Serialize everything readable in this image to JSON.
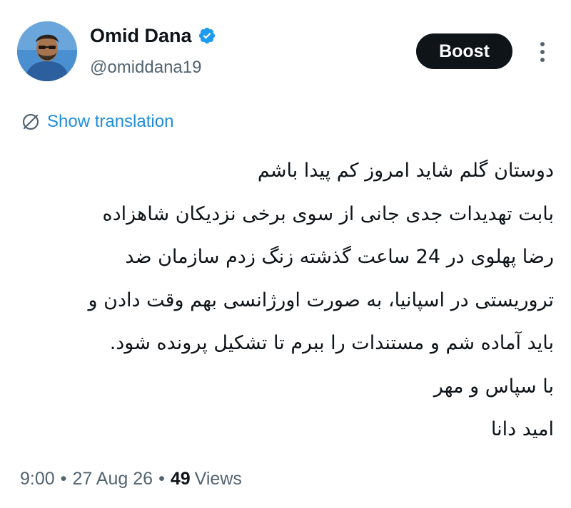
{
  "author": {
    "display_name": "Omid Dana",
    "handle": "@omiddana19",
    "verified_icon": "verified-badge-icon",
    "verified_color": "#1d9bf0"
  },
  "actions": {
    "boost_label": "Boost",
    "more_icon": "more-vertical-icon"
  },
  "translation": {
    "icon": "globe-strike-icon",
    "label": "Show translation"
  },
  "tweet": {
    "lines": [
      "دوستان گلم شاید امروز کم پیدا باشم",
      "بابت تهدیدات جدی جانی از سوی برخی نزدیکان شاهزاده",
      "رضا پهلوی در 24 ساعت گذشته زنگ زدم سازمان ضد",
      "تروریستی در اسپانیا، به صورت اورژانسی بهم وقت دادن و",
      "باید آماده شم و مستندات را ببرم تا تشکیل پرونده شود.",
      "با سپاس و مهر",
      "امید دانا"
    ]
  },
  "meta": {
    "time": "9:00",
    "separator": "•",
    "date": "27 Aug 26",
    "views_count": "49",
    "views_label": "Views"
  },
  "colors": {
    "text_primary": "#0f1419",
    "text_secondary": "#536471",
    "link": "#1d8ddb",
    "button_bg": "#0f1419"
  }
}
